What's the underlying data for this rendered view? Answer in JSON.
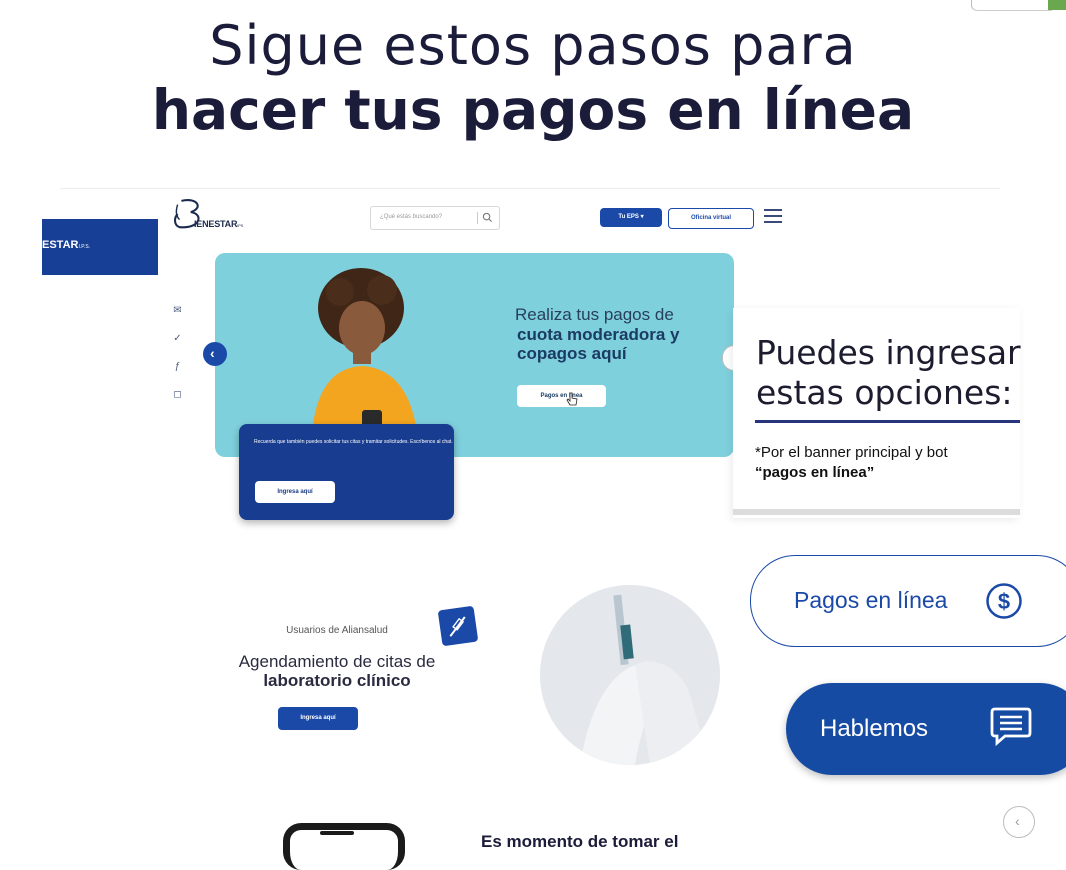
{
  "headline": {
    "line1": "Sigue estos pasos para",
    "line2": "hacer tus pagos en línea"
  },
  "site": {
    "side_banner_text": "ESTAR",
    "side_banner_small": "I.P.S.",
    "logo_text": "IENESTAR",
    "logo_suffix": "IPS",
    "search_placeholder": "¿Qué estás buscando?",
    "tu_eps_label": "Tu EPS ▾",
    "oficina_label": "Oficina virtual"
  },
  "hero": {
    "line1": "Realiza tus pagos de",
    "line2": "cuota moderadora y",
    "line3": "copagos aquí",
    "button_label": "Pagos en línea"
  },
  "chat_card": {
    "text": "Recuerda que también puedes solicitar tus citas y tramitar solicitudes. Escríbenos al chat.",
    "button_label": "Ingresa aquí"
  },
  "options_panel": {
    "title_line1": "Puedes ingresar",
    "title_line2": "estas opciones:",
    "note": "*Por el banner principal y bot",
    "emphasis": "“pagos en línea”"
  },
  "floating": {
    "pagos_label": "Pagos en línea",
    "hablemos_label": "Hablemos"
  },
  "lab": {
    "subtitle": "Usuarios de Aliansalud",
    "title_line1": "Agendamiento de citas de",
    "title_line2": "laboratorio clínico",
    "button_label": "Ingresa aquí"
  },
  "bottom": {
    "title": "Es momento de tomar el"
  },
  "colors": {
    "brand_blue": "#1a49a8",
    "hero_bg": "#7fd0dd",
    "dark_navy": "#173f96"
  }
}
